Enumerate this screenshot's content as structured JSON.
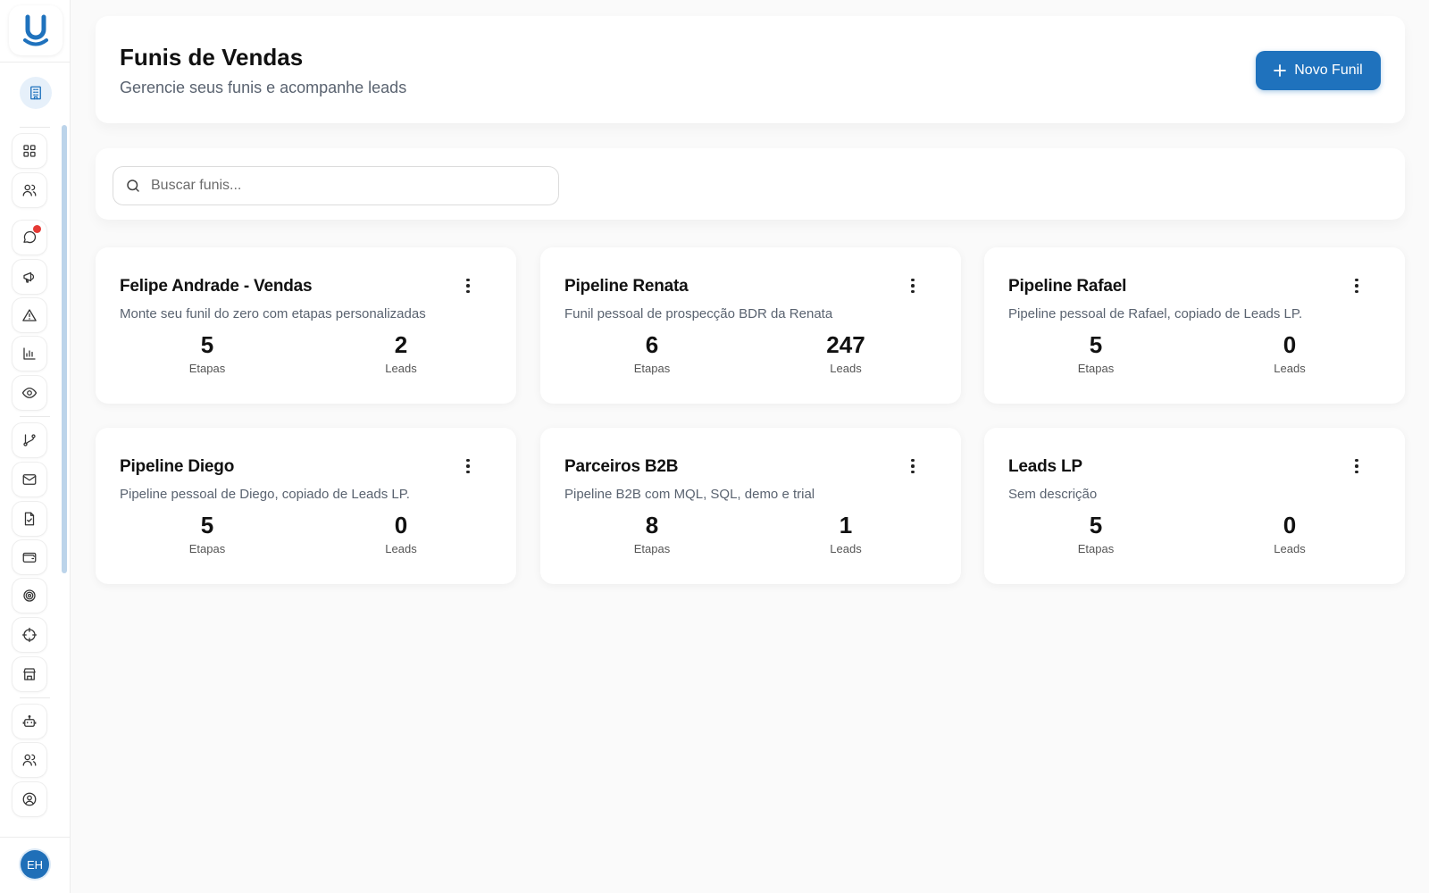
{
  "sidebar": {
    "logo_icon": "u-logo-icon",
    "org_icon": "building-icon",
    "nav_items": [
      {
        "name": "dashboard",
        "icon": "grid-icon"
      },
      {
        "name": "contacts",
        "icon": "users-icon"
      },
      {
        "name": "chat",
        "icon": "message-icon",
        "has_notification": true
      },
      {
        "name": "campaigns",
        "icon": "megaphone-icon"
      },
      {
        "name": "alerts",
        "icon": "alert-triangle-icon"
      },
      {
        "name": "reports",
        "icon": "bar-chart-icon"
      },
      {
        "name": "monitoring",
        "icon": "eye-icon"
      },
      {
        "name": "funnels",
        "icon": "git-branch-icon"
      },
      {
        "name": "email",
        "icon": "mail-icon"
      },
      {
        "name": "documents",
        "icon": "file-check-icon"
      },
      {
        "name": "wallet",
        "icon": "wallet-icon"
      },
      {
        "name": "goals",
        "icon": "target-icon"
      },
      {
        "name": "prospecting",
        "icon": "crosshair-icon"
      },
      {
        "name": "store",
        "icon": "store-icon"
      },
      {
        "name": "bots",
        "icon": "bot-icon"
      },
      {
        "name": "team",
        "icon": "users-icon"
      },
      {
        "name": "profile",
        "icon": "user-circle-icon"
      }
    ],
    "avatar_initials": "EH",
    "notification_color": "#e53935"
  },
  "header": {
    "title": "Funis de Vendas",
    "subtitle": "Gerencie seus funis e acompanhe leads",
    "new_button_label": "Novo Funil",
    "accent_color": "#1f72bd"
  },
  "search": {
    "placeholder": "Buscar funis...",
    "value": ""
  },
  "funnels": [
    {
      "name": "Felipe Andrade - Vendas",
      "description": "Monte seu funil do zero com etapas personalizadas",
      "etapas": "5",
      "leads": "2",
      "etapas_label": "Etapas",
      "leads_label": "Leads"
    },
    {
      "name": "Pipeline Renata",
      "description": "Funil pessoal de prospecção BDR da Renata",
      "etapas": "6",
      "leads": "247",
      "etapas_label": "Etapas",
      "leads_label": "Leads"
    },
    {
      "name": "Pipeline Rafael",
      "description": "Pipeline pessoal de Rafael, copiado de Leads LP.",
      "etapas": "5",
      "leads": "0",
      "etapas_label": "Etapas",
      "leads_label": "Leads"
    },
    {
      "name": "Pipeline Diego",
      "description": "Pipeline pessoal de Diego, copiado de Leads LP.",
      "etapas": "5",
      "leads": "0",
      "etapas_label": "Etapas",
      "leads_label": "Leads"
    },
    {
      "name": "Parceiros B2B",
      "description": "Pipeline B2B com MQL, SQL, demo e trial",
      "etapas": "8",
      "leads": "1",
      "etapas_label": "Etapas",
      "leads_label": "Leads"
    },
    {
      "name": "Leads LP",
      "description": "Sem descrição",
      "etapas": "5",
      "leads": "0",
      "etapas_label": "Etapas",
      "leads_label": "Leads"
    }
  ]
}
